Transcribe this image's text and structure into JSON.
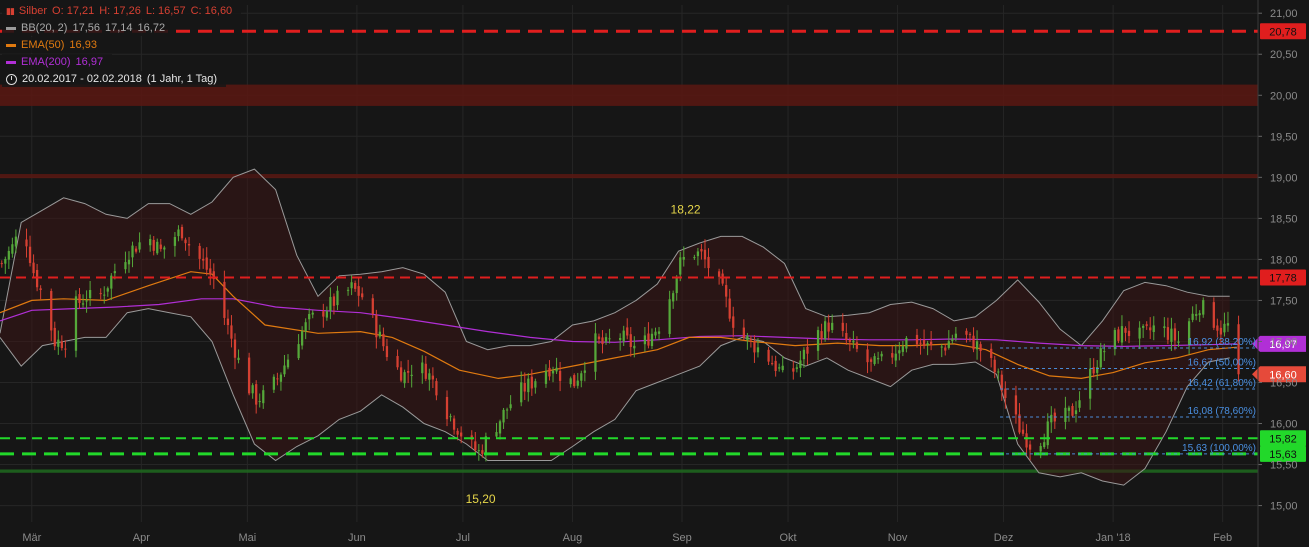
{
  "legend": {
    "symbol": "Silber",
    "ohlc": {
      "o": "O: 17,21",
      "h": "H: 17,26",
      "l": "L: 16,57",
      "c": "C: 16,60"
    },
    "bb": {
      "label": "BB(20, 2)",
      "v1": "17,56",
      "v2": "17,14",
      "v3": "16,72"
    },
    "ema50": {
      "label": "EMA(50)",
      "value": "16,93"
    },
    "ema200": {
      "label": "EMA(200)",
      "value": "16,97"
    },
    "period": "20.02.2017 - 02.02.2018",
    "period_note": "(1 Jahr, 1 Tag)"
  },
  "colors": {
    "background": "#161616",
    "grid": "#262626",
    "up": "#55a83a",
    "down": "#d64032",
    "bb": "#9a9a9a",
    "ema50": "#e07a10",
    "ema200": "#b12fd6",
    "resistance": "#e01e1e",
    "support": "#22d82a",
    "fib": "#4a8ad6"
  },
  "chart_data": {
    "type": "candlestick",
    "y_range": [
      14.8,
      21.1
    ],
    "y_ticks": [
      "21,00",
      "20,50",
      "20,00",
      "19,50",
      "19,00",
      "18,50",
      "18,00",
      "17,50",
      "17,00",
      "16,50",
      "16,00",
      "15,50",
      "15,00"
    ],
    "y_tick_values": [
      21.0,
      20.5,
      20.0,
      19.5,
      19.0,
      18.5,
      18.0,
      17.5,
      17.0,
      16.5,
      16.0,
      15.5,
      15.0
    ],
    "x_ticks": [
      "Mär",
      "Apr",
      "Mai",
      "Jun",
      "Jul",
      "Aug",
      "Sep",
      "Okt",
      "Nov",
      "Dez",
      "Jan '18",
      "Feb"
    ],
    "x_tick_days": [
      9,
      40,
      70,
      101,
      131,
      162,
      193,
      223,
      254,
      284,
      315,
      346
    ],
    "x_range_days": [
      0,
      356
    ],
    "zones": [
      {
        "from": 19.87,
        "to": 20.13
      },
      {
        "from": 18.99,
        "to": 19.04
      },
      {
        "from": 15.4,
        "to": 15.44
      }
    ],
    "horizontal_lines": [
      {
        "value": 20.78,
        "label": "20,78",
        "color": "#e01e1e",
        "style": "dashed",
        "width": 3
      },
      {
        "value": 17.78,
        "label": "17,78",
        "color": "#e01e1e",
        "style": "dashed",
        "width": 2
      },
      {
        "value": 15.82,
        "label": "15,82",
        "color": "#22d82a",
        "style": "dashed",
        "width": 2
      },
      {
        "value": 15.63,
        "label": "15,63",
        "color": "#22d82a",
        "style": "dashed",
        "width": 3
      }
    ],
    "fib_levels": [
      {
        "value": 16.92,
        "label": "16,92 (38,20%)"
      },
      {
        "value": 16.67,
        "label": "16,67 (50,00%)"
      },
      {
        "value": 16.42,
        "label": "16,42 (61,80%)"
      },
      {
        "value": 16.08,
        "label": "16,08 (78,60%)"
      },
      {
        "value": 15.63,
        "label": "15,63 (100,00%)"
      }
    ],
    "fib_start_day": 283,
    "price_labels": [
      {
        "value": 16.97,
        "label": "16,97",
        "color": "#b12fd6"
      },
      {
        "value": 16.6,
        "label": "16,60",
        "color": "#e64a3a"
      }
    ],
    "annotations": [
      {
        "day": 194,
        "value": 18.22,
        "label": "18,22",
        "position": "above"
      },
      {
        "day": 136,
        "value": 15.2,
        "label": "15,20",
        "position": "below"
      }
    ],
    "close_path": [
      [
        0,
        17.95
      ],
      [
        3,
        18.15
      ],
      [
        6,
        18.42
      ],
      [
        9,
        17.85
      ],
      [
        12,
        17.5
      ],
      [
        15,
        17.0
      ],
      [
        18,
        17.0
      ],
      [
        21,
        17.45
      ],
      [
        24,
        17.55
      ],
      [
        27,
        17.5
      ],
      [
        30,
        17.7
      ],
      [
        33,
        17.95
      ],
      [
        36,
        18.1
      ],
      [
        39,
        18.2
      ],
      [
        42,
        18.25
      ],
      [
        45,
        18.1
      ],
      [
        48,
        18.25
      ],
      [
        51,
        18.35
      ],
      [
        54,
        18.1
      ],
      [
        57,
        17.95
      ],
      [
        60,
        17.75
      ],
      [
        63,
        17.3
      ],
      [
        66,
        16.9
      ],
      [
        69,
        16.5
      ],
      [
        72,
        16.3
      ],
      [
        75,
        16.35
      ],
      [
        78,
        16.55
      ],
      [
        81,
        16.8
      ],
      [
        84,
        17.05
      ],
      [
        87,
        17.25
      ],
      [
        90,
        17.35
      ],
      [
        93,
        17.45
      ],
      [
        96,
        17.55
      ],
      [
        99,
        17.65
      ],
      [
        102,
        17.55
      ],
      [
        105,
        17.25
      ],
      [
        108,
        16.95
      ],
      [
        111,
        16.7
      ],
      [
        114,
        16.6
      ],
      [
        117,
        16.7
      ],
      [
        120,
        16.65
      ],
      [
        123,
        16.45
      ],
      [
        126,
        16.15
      ],
      [
        129,
        15.95
      ],
      [
        132,
        15.75
      ],
      [
        135,
        15.65
      ],
      [
        138,
        15.85
      ],
      [
        141,
        16.05
      ],
      [
        144,
        16.25
      ],
      [
        147,
        16.4
      ],
      [
        150,
        16.5
      ],
      [
        153,
        16.65
      ],
      [
        156,
        16.7
      ],
      [
        159,
        16.55
      ],
      [
        162,
        16.5
      ],
      [
        165,
        16.75
      ],
      [
        168,
        17.0
      ],
      [
        171,
        16.95
      ],
      [
        174,
        17.1
      ],
      [
        177,
        17.0
      ],
      [
        180,
        16.9
      ],
      [
        183,
        17.05
      ],
      [
        186,
        17.2
      ],
      [
        189,
        17.55
      ],
      [
        192,
        17.95
      ],
      [
        195,
        18.1
      ],
      [
        198,
        18.05
      ],
      [
        201,
        17.85
      ],
      [
        204,
        17.6
      ],
      [
        207,
        17.25
      ],
      [
        210,
        17.05
      ],
      [
        213,
        16.95
      ],
      [
        216,
        16.85
      ],
      [
        219,
        16.7
      ],
      [
        222,
        16.55
      ],
      [
        225,
        16.7
      ],
      [
        228,
        16.9
      ],
      [
        231,
        17.1
      ],
      [
        234,
        17.2
      ],
      [
        237,
        17.1
      ],
      [
        240,
        16.95
      ],
      [
        243,
        16.85
      ],
      [
        246,
        16.7
      ],
      [
        249,
        16.75
      ],
      [
        252,
        16.85
      ],
      [
        255,
        17.0
      ],
      [
        258,
        17.05
      ],
      [
        261,
        16.95
      ],
      [
        264,
        16.9
      ],
      [
        267,
        16.95
      ],
      [
        270,
        17.1
      ],
      [
        273,
        17.05
      ],
      [
        276,
        16.95
      ],
      [
        279,
        16.8
      ],
      [
        282,
        16.55
      ],
      [
        285,
        16.2
      ],
      [
        288,
        15.95
      ],
      [
        291,
        15.75
      ],
      [
        294,
        15.82
      ],
      [
        297,
        16.0
      ],
      [
        300,
        16.05
      ],
      [
        303,
        16.15
      ],
      [
        306,
        16.4
      ],
      [
        309,
        16.7
      ],
      [
        312,
        16.9
      ],
      [
        315,
        17.05
      ],
      [
        318,
        17.15
      ],
      [
        321,
        17.05
      ],
      [
        324,
        17.1
      ],
      [
        327,
        17.2
      ],
      [
        330,
        17.1
      ],
      [
        333,
        17.0
      ],
      [
        336,
        17.25
      ],
      [
        339,
        17.45
      ],
      [
        342,
        17.3
      ],
      [
        345,
        17.15
      ],
      [
        348,
        17.21
      ],
      [
        350,
        16.6
      ]
    ],
    "ema50_path": [
      [
        0,
        17.35
      ],
      [
        9,
        17.5
      ],
      [
        18,
        17.52
      ],
      [
        30,
        17.5
      ],
      [
        42,
        17.68
      ],
      [
        54,
        17.85
      ],
      [
        60,
        17.82
      ],
      [
        66,
        17.55
      ],
      [
        75,
        17.2
      ],
      [
        90,
        17.1
      ],
      [
        102,
        17.12
      ],
      [
        111,
        17.05
      ],
      [
        120,
        16.88
      ],
      [
        130,
        16.65
      ],
      [
        141,
        16.55
      ],
      [
        150,
        16.6
      ],
      [
        162,
        16.7
      ],
      [
        174,
        16.8
      ],
      [
        186,
        16.9
      ],
      [
        195,
        17.05
      ],
      [
        204,
        17.05
      ],
      [
        213,
        17.0
      ],
      [
        225,
        16.95
      ],
      [
        237,
        16.98
      ],
      [
        249,
        16.95
      ],
      [
        258,
        16.95
      ],
      [
        270,
        16.97
      ],
      [
        279,
        16.9
      ],
      [
        288,
        16.72
      ],
      [
        297,
        16.58
      ],
      [
        306,
        16.55
      ],
      [
        315,
        16.62
      ],
      [
        324,
        16.74
      ],
      [
        333,
        16.8
      ],
      [
        342,
        16.9
      ],
      [
        350,
        16.93
      ]
    ],
    "ema200_path": [
      [
        0,
        17.25
      ],
      [
        9,
        17.38
      ],
      [
        21,
        17.4
      ],
      [
        33,
        17.42
      ],
      [
        45,
        17.45
      ],
      [
        57,
        17.52
      ],
      [
        66,
        17.52
      ],
      [
        78,
        17.42
      ],
      [
        90,
        17.38
      ],
      [
        102,
        17.35
      ],
      [
        114,
        17.28
      ],
      [
        126,
        17.2
      ],
      [
        138,
        17.12
      ],
      [
        150,
        17.05
      ],
      [
        162,
        17.0
      ],
      [
        174,
        16.99
      ],
      [
        186,
        17.02
      ],
      [
        198,
        17.06
      ],
      [
        210,
        17.07
      ],
      [
        222,
        17.05
      ],
      [
        234,
        17.03
      ],
      [
        246,
        17.02
      ],
      [
        258,
        17.02
      ],
      [
        270,
        17.03
      ],
      [
        282,
        17.02
      ],
      [
        294,
        16.98
      ],
      [
        306,
        16.95
      ],
      [
        318,
        16.94
      ],
      [
        330,
        16.95
      ],
      [
        342,
        16.96
      ],
      [
        350,
        16.97
      ]
    ],
    "bb_upper_path": [
      [
        0,
        17.1
      ],
      [
        6,
        18.45
      ],
      [
        12,
        18.6
      ],
      [
        18,
        18.75
      ],
      [
        24,
        18.68
      ],
      [
        30,
        18.55
      ],
      [
        36,
        18.5
      ],
      [
        42,
        18.68
      ],
      [
        48,
        18.68
      ],
      [
        54,
        18.55
      ],
      [
        60,
        18.7
      ],
      [
        66,
        19.0
      ],
      [
        72,
        19.1
      ],
      [
        78,
        18.85
      ],
      [
        84,
        18.05
      ],
      [
        90,
        17.55
      ],
      [
        96,
        17.8
      ],
      [
        102,
        17.82
      ],
      [
        108,
        17.85
      ],
      [
        114,
        17.9
      ],
      [
        120,
        17.82
      ],
      [
        126,
        17.6
      ],
      [
        132,
        17.0
      ],
      [
        138,
        16.9
      ],
      [
        144,
        16.95
      ],
      [
        150,
        16.95
      ],
      [
        156,
        17.0
      ],
      [
        162,
        17.2
      ],
      [
        168,
        17.25
      ],
      [
        174,
        17.35
      ],
      [
        180,
        17.5
      ],
      [
        186,
        17.7
      ],
      [
        192,
        18.1
      ],
      [
        198,
        18.2
      ],
      [
        204,
        18.28
      ],
      [
        210,
        18.28
      ],
      [
        216,
        18.15
      ],
      [
        222,
        17.95
      ],
      [
        228,
        17.4
      ],
      [
        234,
        17.3
      ],
      [
        240,
        17.32
      ],
      [
        246,
        17.35
      ],
      [
        252,
        17.45
      ],
      [
        258,
        17.48
      ],
      [
        264,
        17.4
      ],
      [
        270,
        17.25
      ],
      [
        276,
        17.3
      ],
      [
        282,
        17.5
      ],
      [
        288,
        17.75
      ],
      [
        294,
        17.48
      ],
      [
        300,
        17.15
      ],
      [
        306,
        16.95
      ],
      [
        312,
        17.25
      ],
      [
        318,
        17.62
      ],
      [
        324,
        17.72
      ],
      [
        330,
        17.68
      ],
      [
        336,
        17.6
      ],
      [
        342,
        17.55
      ],
      [
        348,
        17.55
      ]
    ],
    "bb_lower_path": [
      [
        0,
        17.05
      ],
      [
        6,
        16.7
      ],
      [
        12,
        16.95
      ],
      [
        18,
        17.0
      ],
      [
        24,
        17.05
      ],
      [
        30,
        17.05
      ],
      [
        36,
        17.35
      ],
      [
        42,
        17.4
      ],
      [
        48,
        17.35
      ],
      [
        54,
        17.3
      ],
      [
        60,
        17.0
      ],
      [
        66,
        16.35
      ],
      [
        72,
        15.75
      ],
      [
        78,
        15.55
      ],
      [
        84,
        15.72
      ],
      [
        90,
        15.85
      ],
      [
        96,
        16.05
      ],
      [
        102,
        16.15
      ],
      [
        108,
        16.35
      ],
      [
        114,
        16.2
      ],
      [
        120,
        16.0
      ],
      [
        126,
        15.9
      ],
      [
        132,
        15.75
      ],
      [
        138,
        15.55
      ],
      [
        144,
        15.55
      ],
      [
        150,
        15.55
      ],
      [
        156,
        15.55
      ],
      [
        162,
        15.72
      ],
      [
        168,
        15.9
      ],
      [
        174,
        16.05
      ],
      [
        180,
        16.4
      ],
      [
        186,
        16.5
      ],
      [
        192,
        16.6
      ],
      [
        198,
        16.7
      ],
      [
        204,
        16.95
      ],
      [
        210,
        17.05
      ],
      [
        216,
        17.0
      ],
      [
        222,
        16.8
      ],
      [
        228,
        16.7
      ],
      [
        234,
        16.8
      ],
      [
        240,
        16.65
      ],
      [
        246,
        16.55
      ],
      [
        252,
        16.45
      ],
      [
        258,
        16.65
      ],
      [
        264,
        16.72
      ],
      [
        270,
        16.72
      ],
      [
        276,
        16.75
      ],
      [
        282,
        16.6
      ],
      [
        288,
        15.75
      ],
      [
        294,
        15.4
      ],
      [
        300,
        15.35
      ],
      [
        306,
        15.4
      ],
      [
        312,
        15.3
      ],
      [
        318,
        15.25
      ],
      [
        324,
        15.45
      ],
      [
        330,
        15.9
      ],
      [
        336,
        16.45
      ],
      [
        342,
        16.75
      ],
      [
        348,
        16.8
      ]
    ]
  }
}
